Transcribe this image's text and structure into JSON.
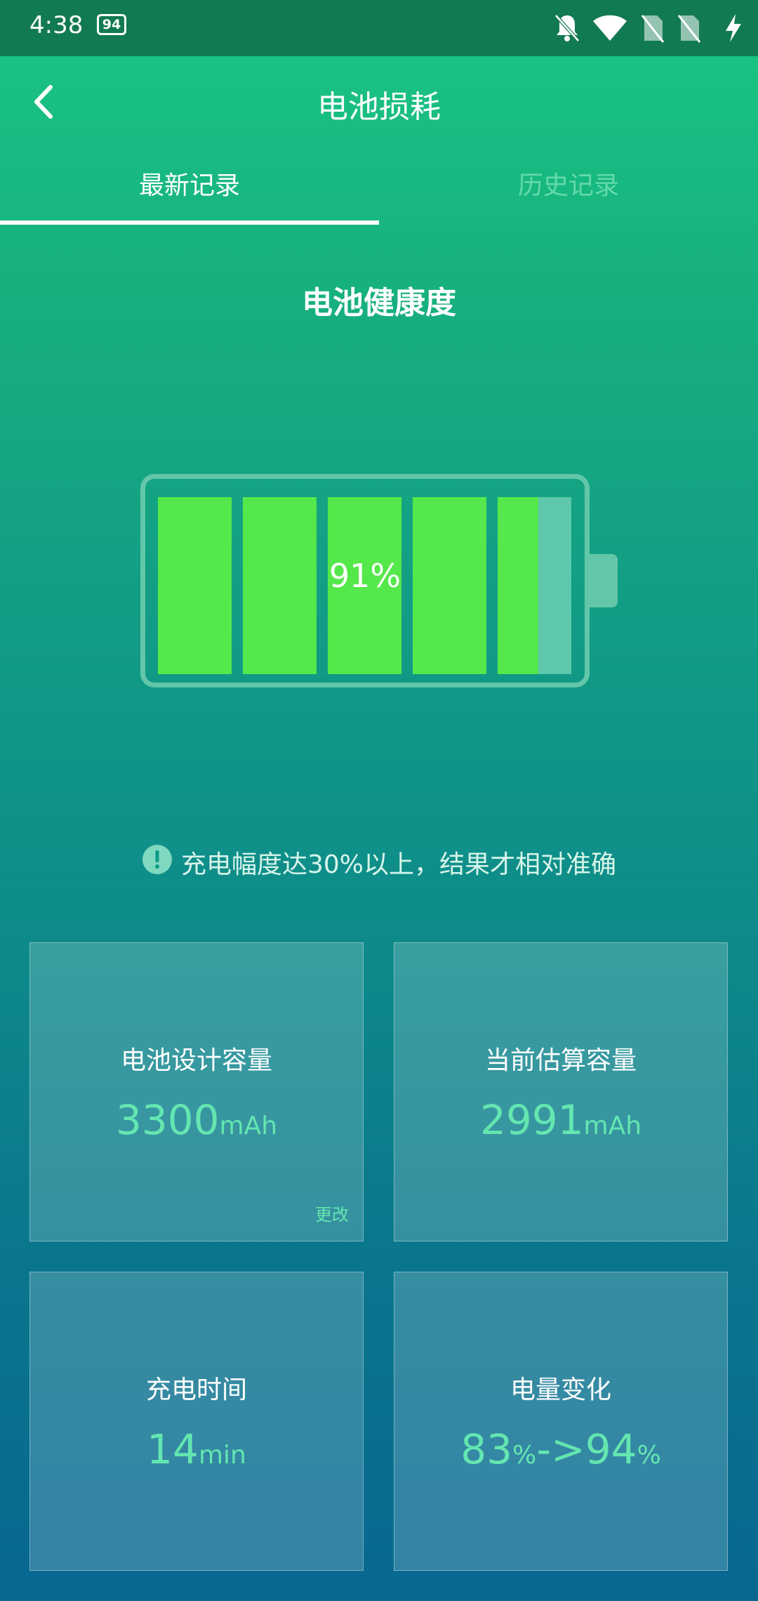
{
  "status_bar": {
    "time": "4:38",
    "notification_badge": "94",
    "icons": [
      "bell-off-icon",
      "wifi-icon",
      "no-sim-icon",
      "no-sim-icon",
      "charging-icon"
    ]
  },
  "header": {
    "title": "电池损耗",
    "back_icon": "chevron-left-icon"
  },
  "tabs": [
    {
      "label": "最新记录",
      "active": true
    },
    {
      "label": "历史记录",
      "active": false
    }
  ],
  "battery_health": {
    "title": "电池健康度",
    "percent_label": "91%",
    "percent": 91
  },
  "tip": {
    "icon": "exclamation-circle-icon",
    "text": "充电幅度达30%以上，结果才相对准确"
  },
  "cards": {
    "design_capacity": {
      "label": "电池设计容量",
      "value": "3300",
      "unit": "mAh",
      "edit_label": "更改"
    },
    "estimated_capacity": {
      "label": "当前估算容量",
      "value": "2991",
      "unit": "mAh"
    },
    "charge_time": {
      "label": "充电时间",
      "value": "14",
      "unit": "min"
    },
    "charge_change": {
      "label": "电量变化",
      "from": "83",
      "from_unit": "%",
      "arrow": "->",
      "to": "94",
      "to_unit": "%"
    }
  },
  "colors": {
    "accent_green": "#55e84b",
    "value_text": "#64e6b0",
    "status_bar": "#127a52"
  }
}
